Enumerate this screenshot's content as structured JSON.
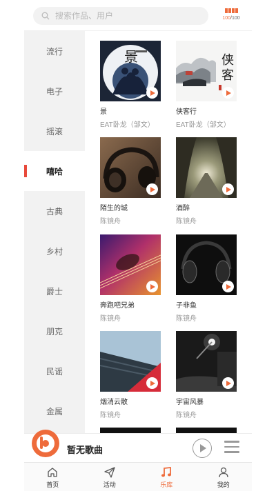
{
  "header": {
    "search_placeholder": "搜索作品、用户",
    "status": {
      "current": "100",
      "total": "/100"
    }
  },
  "sidebar": {
    "items": [
      {
        "label": "流行"
      },
      {
        "label": "电子"
      },
      {
        "label": "摇滚"
      },
      {
        "label": "嘻哈",
        "active": true
      },
      {
        "label": "古典"
      },
      {
        "label": "乡村"
      },
      {
        "label": "爵士"
      },
      {
        "label": "朋克"
      },
      {
        "label": "民谣"
      },
      {
        "label": "金属"
      }
    ]
  },
  "songs": [
    {
      "title": "景",
      "artist": "EAT卧龙（邹文）",
      "cover": "jing"
    },
    {
      "title": "侠客行",
      "artist": "EAT卧龙（邹文）",
      "cover": "xiakexing"
    },
    {
      "title": "陌生的城",
      "artist": "陈镜舟",
      "cover": "headphones"
    },
    {
      "title": "酒醉",
      "artist": "陈镜舟",
      "cover": "tree-road"
    },
    {
      "title": "奔跑吧兄弟",
      "artist": "陈镜舟",
      "cover": "guitar"
    },
    {
      "title": "子非鱼",
      "artist": "陈镜舟",
      "cover": "dark-headphones"
    },
    {
      "title": "烟消云散",
      "artist": "陈镜舟",
      "cover": "building"
    },
    {
      "title": "宇宙风暴",
      "artist": "陈镜舟",
      "cover": "night-street"
    }
  ],
  "player": {
    "now_playing": "暂无歌曲"
  },
  "tabs": [
    {
      "label": "首页",
      "icon": "home-icon"
    },
    {
      "label": "活动",
      "icon": "send-icon"
    },
    {
      "label": "乐库",
      "icon": "music-note-icon",
      "active": true
    },
    {
      "label": "我的",
      "icon": "user-icon"
    }
  ],
  "colors": {
    "accent": "#ee6b3b",
    "active_marker": "#e8493b"
  }
}
